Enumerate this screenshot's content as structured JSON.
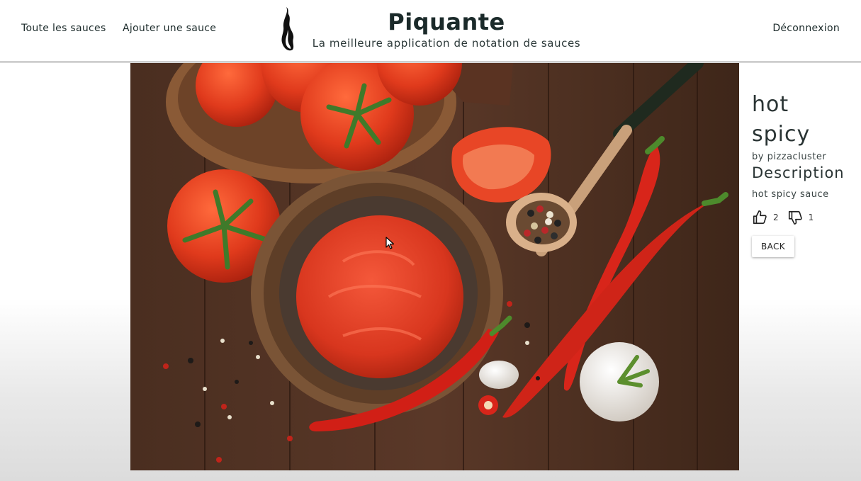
{
  "nav": {
    "all_sauces": "Toute les sauces",
    "add_sauce": "Ajouter une sauce",
    "logout": "Déconnexion"
  },
  "brand": {
    "title": "Piquante",
    "subtitle": "La meilleure application de notation de sauces",
    "logo_icon": "flame-icon"
  },
  "sauce": {
    "name_line1": "hot",
    "name_line2": "spicy",
    "by": "by pizzacluster",
    "description_heading": "Description",
    "description": "hot spicy sauce",
    "likes": "2",
    "dislikes": "1",
    "back_label": "BACK",
    "image_subject": "tomato sauce bowl with tomatoes, chili peppers, garlic and peppercorns on dark wooden table"
  },
  "icons": {
    "like": "thumbs-up-icon",
    "dislike": "thumbs-down-icon"
  },
  "colors": {
    "text": "#1e2b2b",
    "header_border": "#555555",
    "sauce_red": "#d83a22",
    "wood": "#3a241a"
  }
}
